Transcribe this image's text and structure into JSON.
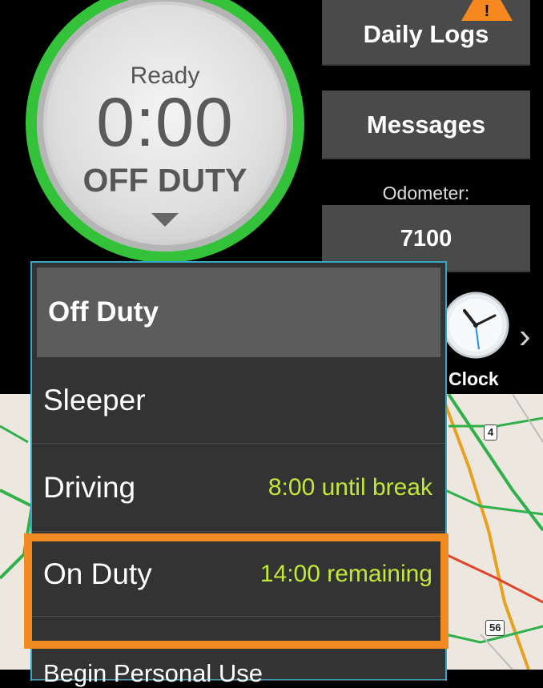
{
  "status": {
    "state_label": "Ready",
    "timer": "0:00",
    "duty": "OFF DUTY"
  },
  "buttons": {
    "daily_logs": "Daily Logs",
    "messages": "Messages"
  },
  "odometer": {
    "label": "Odometer:",
    "value": "7100"
  },
  "clock": {
    "label": "Clock"
  },
  "menu": {
    "items": [
      {
        "label": "Off Duty",
        "note": ""
      },
      {
        "label": "Sleeper",
        "note": ""
      },
      {
        "label": "Driving",
        "note": "8:00 until break"
      },
      {
        "label": "On Duty",
        "note": "14:00 remaining"
      },
      {
        "label": "Begin Personal Use",
        "note": ""
      }
    ]
  },
  "map": {
    "route_badges": [
      "4",
      "56"
    ]
  },
  "colors": {
    "ring": "#34c23a",
    "accent_note": "#c3e83a",
    "highlight": "#f28c22",
    "warning": "#f5891f"
  },
  "icons": [
    "warning-icon",
    "clock-icon",
    "chevron-right-icon",
    "dropdown-arrow-icon"
  ]
}
